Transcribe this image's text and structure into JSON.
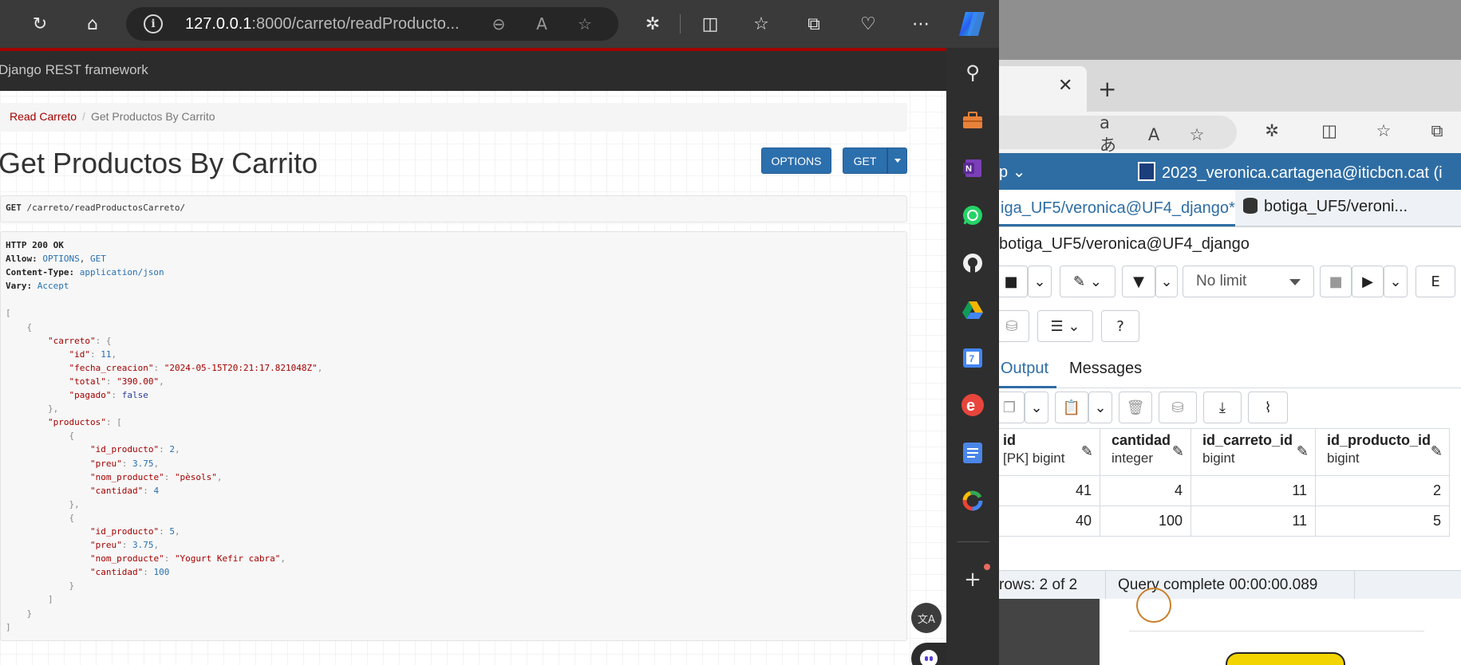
{
  "left_browser": {
    "address_bar": {
      "host": "127.0.0.1",
      "path": ":8000/carreto/readProducto..."
    },
    "toolbar_icons": [
      "refresh-icon",
      "home-icon",
      "info-icon",
      "zoom-out-icon",
      "read-aloud-icon",
      "favorite-star-icon",
      "extensions-icon",
      "split-screen-icon",
      "favorites-icon",
      "collections-icon",
      "browser-essentials-icon",
      "more-icon",
      "copilot-icon"
    ]
  },
  "drf_page": {
    "brand": "Django REST framework",
    "breadcrumb": {
      "parent": "Read Carreto",
      "separator": "/",
      "current": "Get Productos By Carrito"
    },
    "title": "Get Productos By Carrito",
    "buttons": {
      "options": "OPTIONS",
      "get": "GET"
    },
    "request": {
      "method": "GET",
      "path": "/carreto/readProductosCarreto/"
    },
    "response_headers": {
      "status": "HTTP 200 OK",
      "allow_label": "Allow:",
      "allow_value_1": "OPTIONS",
      "allow_comma": ",",
      "allow_value_2": "GET",
      "content_type_label": "Content-Type:",
      "content_type_value": "application/json",
      "vary_label": "Vary:",
      "vary_value": "Accept"
    },
    "response_body": {
      "carreto": {
        "id": "11",
        "fecha_creacion": "\"2024-05-15T20:21:17.821048Z\"",
        "total": "\"390.00\"",
        "pagado": "false"
      },
      "productos": [
        {
          "id_producto": "2",
          "preu": "3.75",
          "nom_producte": "\"pèsols\"",
          "cantidad": "4"
        },
        {
          "id_producto": "5",
          "preu": "3.75",
          "nom_producte": "\"Yogurt Kefir cabra\"",
          "cantidad": "100"
        }
      ]
    }
  },
  "sidebar": {
    "items": [
      "search-icon",
      "toolbox-icon",
      "onenote-icon",
      "whatsapp-icon",
      "github-icon",
      "google-drive-icon",
      "calendar-icon",
      "e-icon",
      "google-docs-icon",
      "google-icon"
    ],
    "calendar_day": "7",
    "add_label": "+"
  },
  "right_browser": {
    "tab_close": "✕",
    "new_tab": "+",
    "pgadmin": {
      "menu_fragment": "p",
      "user": "2023_veronica.cartagena@iticbcn.cat (i",
      "query_tabs": [
        {
          "label": "iga_UF5/veronica@UF4_django*",
          "close": "✕"
        },
        {
          "label": "botiga_UF5/veroni..."
        }
      ],
      "connection": "botiga_UF5/veronica@UF4_django",
      "limit": "No limit",
      "output_tabs": {
        "output": "Output",
        "messages": "Messages"
      },
      "columns": [
        {
          "name": "id",
          "type": "[PK] bigint"
        },
        {
          "name": "cantidad",
          "type": "integer"
        },
        {
          "name": "id_carreto_id",
          "type": "bigint"
        },
        {
          "name": "id_producto_id",
          "type": "bigint"
        }
      ],
      "rows": [
        [
          "41",
          "4",
          "11",
          "2"
        ],
        [
          "40",
          "100",
          "11",
          "5"
        ]
      ],
      "status": {
        "rows": "rows: 2 of 2",
        "query": "Query complete 00:00:00.089"
      }
    }
  },
  "colors": {
    "drf_red": "#a30000",
    "drf_blue": "#2c6fad",
    "pgadmin_blue": "#2e6da4"
  }
}
